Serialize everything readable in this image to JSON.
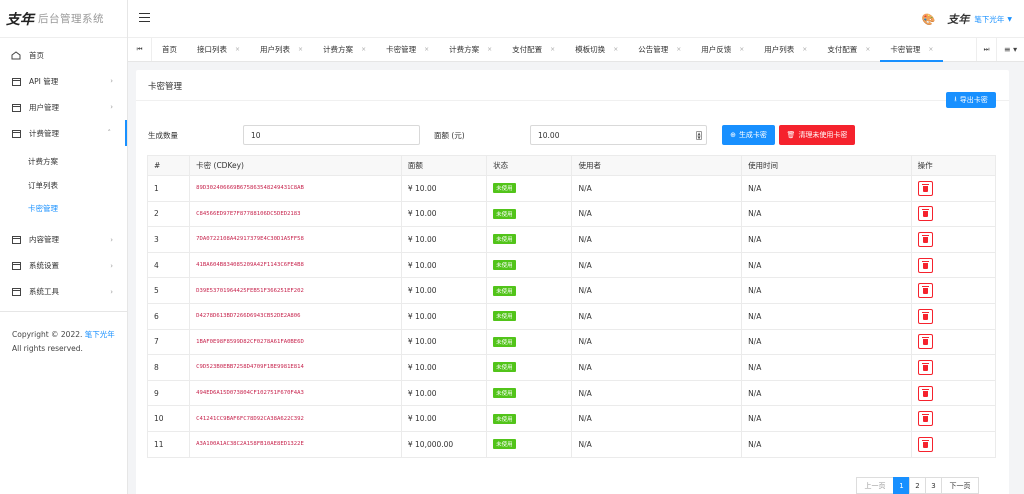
{
  "brand": {
    "logo_text": "支年",
    "title": "后台管理系统"
  },
  "sidebar": {
    "items": [
      {
        "label": "首页",
        "icon": "home-icon"
      },
      {
        "label": "API 管理",
        "icon": "calendar-icon"
      },
      {
        "label": "用户管理",
        "icon": "calendar-icon"
      },
      {
        "label": "计费管理",
        "icon": "calendar-icon",
        "open": true
      }
    ],
    "submenu": [
      {
        "label": "计费方案"
      },
      {
        "label": "订单列表"
      },
      {
        "label": "卡密管理",
        "active": true
      }
    ],
    "items_after": [
      {
        "label": "内容管理",
        "icon": "calendar-icon"
      },
      {
        "label": "系统设置",
        "icon": "calendar-icon"
      },
      {
        "label": "系统工具",
        "icon": "calendar-icon"
      }
    ],
    "copyright_prefix": "Copyright © 2022.",
    "copyright_link": "笔下光年",
    "copyright_suffix": "All rights reserved."
  },
  "header": {
    "username": "笔下光年",
    "avatar_text": "支年"
  },
  "tabs": [
    "首页",
    "接口列表",
    "用户列表",
    "计费方案",
    "卡密管理",
    "计费方案",
    "支付配置",
    "模板切换",
    "公告管理",
    "用户反馈",
    "用户列表",
    "支付配置",
    "卡密管理"
  ],
  "active_tab_index": 12,
  "card": {
    "title": "卡密管理",
    "export_label": "导出卡密",
    "gen_count_label": "生成数量",
    "gen_count_value": "10",
    "amount_label": "面额 (元)",
    "amount_value": "10.00",
    "generate_label": "生成卡密",
    "clean_label": "清理未使用卡密"
  },
  "table": {
    "headers": [
      "#",
      "卡密 (CDKey)",
      "面额",
      "状态",
      "使用者",
      "使用时间",
      "操作"
    ],
    "rows": [
      {
        "id": "1",
        "key": "89D302406669B675863548249431C8AB",
        "amount": "¥ 10.00",
        "status": "未使用",
        "user": "N/A",
        "time": "N/A"
      },
      {
        "id": "2",
        "key": "C84566ED97E7F87788106DC5DED2183",
        "amount": "¥ 10.00",
        "status": "未使用",
        "user": "N/A",
        "time": "N/A"
      },
      {
        "id": "3",
        "key": "7DA0722108A42917379E4C30D1A5FF58",
        "amount": "¥ 10.00",
        "status": "未使用",
        "user": "N/A",
        "time": "N/A"
      },
      {
        "id": "4",
        "key": "41BA604B834085209A42F1143C6FE4B8",
        "amount": "¥ 10.00",
        "status": "未使用",
        "user": "N/A",
        "time": "N/A"
      },
      {
        "id": "5",
        "key": "D39E53701964425FEB51F366251EF202",
        "amount": "¥ 10.00",
        "status": "未使用",
        "user": "N/A",
        "time": "N/A"
      },
      {
        "id": "6",
        "key": "D4278D613BD7266D6943CB52DE2A806",
        "amount": "¥ 10.00",
        "status": "未使用",
        "user": "N/A",
        "time": "N/A"
      },
      {
        "id": "7",
        "key": "1BAF0E98F8599D82CF0278A61FA0BE6D",
        "amount": "¥ 10.00",
        "status": "未使用",
        "user": "N/A",
        "time": "N/A"
      },
      {
        "id": "8",
        "key": "C9D523B0EBB7258D4709F1BE9981E814",
        "amount": "¥ 10.00",
        "status": "未使用",
        "user": "N/A",
        "time": "N/A"
      },
      {
        "id": "9",
        "key": "494ED6A15D073804CF102751F670F4A3",
        "amount": "¥ 10.00",
        "status": "未使用",
        "user": "N/A",
        "time": "N/A"
      },
      {
        "id": "10",
        "key": "C41241CC9BAF6FC78D92CA38A622C392",
        "amount": "¥ 10.00",
        "status": "未使用",
        "user": "N/A",
        "time": "N/A"
      },
      {
        "id": "11",
        "key": "A3A100A1AC38C2A158FB10AE8ED1322E",
        "amount": "¥ 10,000.00",
        "status": "未使用",
        "user": "N/A",
        "time": "N/A"
      }
    ]
  },
  "pagination": {
    "prev": "上一页",
    "pages": [
      "1",
      "2",
      "3"
    ],
    "current": "1",
    "next": "下一页"
  },
  "colors": {
    "primary": "#1890ff",
    "danger": "#f5222d",
    "success": "#52c41a",
    "cdkey": "#c7254e"
  }
}
